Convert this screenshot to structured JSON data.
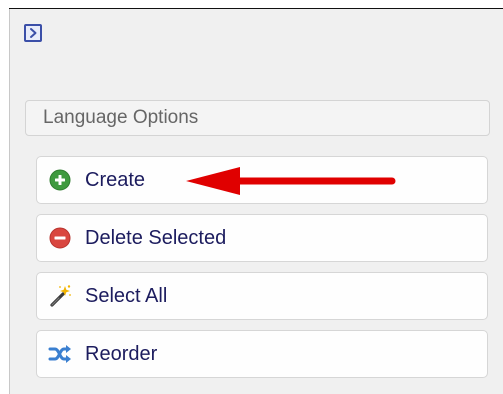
{
  "panel": {
    "toggle_icon": "chevron-right-icon",
    "section_header": "Language Options",
    "actions": [
      {
        "label": "Create",
        "icon": "plus-circle-icon",
        "icon_color": "#3f9a3f"
      },
      {
        "label": "Delete Selected",
        "icon": "minus-circle-icon",
        "icon_color": "#d9463f"
      },
      {
        "label": "Select All",
        "icon": "magic-wand-icon",
        "icon_color": "#e8a400"
      },
      {
        "label": "Reorder",
        "icon": "shuffle-icon",
        "icon_color": "#3a7fd0"
      }
    ]
  },
  "annotation": {
    "arrow_color": "#e00000",
    "points_to": "Create"
  }
}
